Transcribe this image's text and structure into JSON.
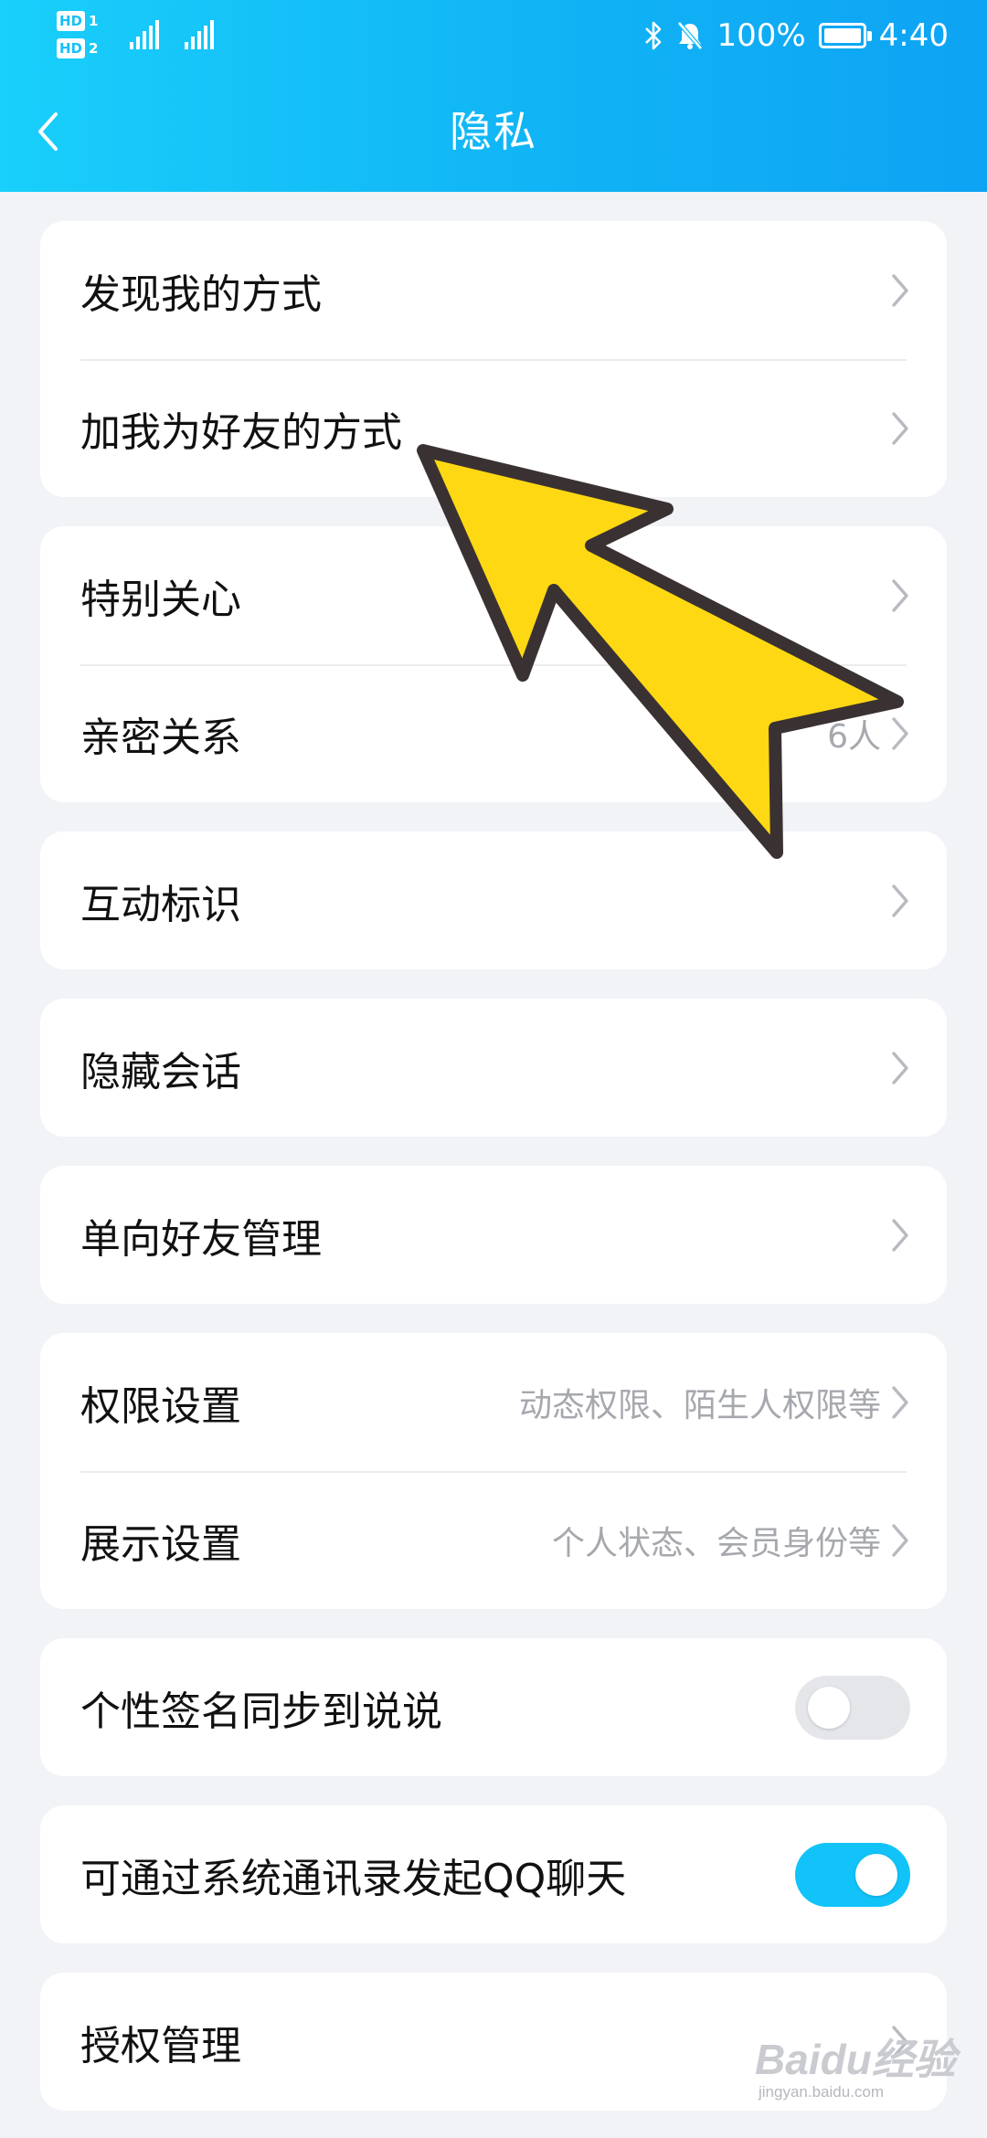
{
  "status_bar": {
    "sim1_tag": "HD",
    "sim1_num": "1",
    "sim2_tag": "HD",
    "sim2_num": "2",
    "battery": "100%",
    "battery_level": 1.0,
    "time": "4:40"
  },
  "header": {
    "title": "隐私"
  },
  "groups": [
    {
      "rows": [
        {
          "label": "发现我的方式",
          "value": ""
        },
        {
          "label": "加我为好友的方式",
          "value": ""
        }
      ]
    },
    {
      "rows": [
        {
          "label": "特别关心",
          "value": ""
        },
        {
          "label": "亲密关系",
          "value": "6人"
        }
      ]
    },
    {
      "rows": [
        {
          "label": "互动标识",
          "value": ""
        }
      ]
    },
    {
      "rows": [
        {
          "label": "隐藏会话",
          "value": ""
        }
      ]
    },
    {
      "rows": [
        {
          "label": "单向好友管理",
          "value": ""
        }
      ]
    },
    {
      "rows": [
        {
          "label": "权限设置",
          "value": "动态权限、陌生人权限等"
        },
        {
          "label": "展示设置",
          "value": "个人状态、会员身份等"
        }
      ]
    }
  ],
  "toggles": [
    {
      "label": "个性签名同步到说说",
      "on": false
    },
    {
      "label": "可通过系统通讯录发起QQ聊天",
      "on": true
    }
  ],
  "authorization": {
    "label": "授权管理"
  },
  "colors": {
    "header_start": "#19cffb",
    "header_end": "#0ea3f4",
    "toggle_on": "#12c3fa",
    "annotation_arrow_fill": "#ffd814",
    "annotation_arrow_stroke": "#3a3232"
  },
  "watermark": {
    "brand": "Baidu经验",
    "url": "jingyan.baidu.com"
  }
}
